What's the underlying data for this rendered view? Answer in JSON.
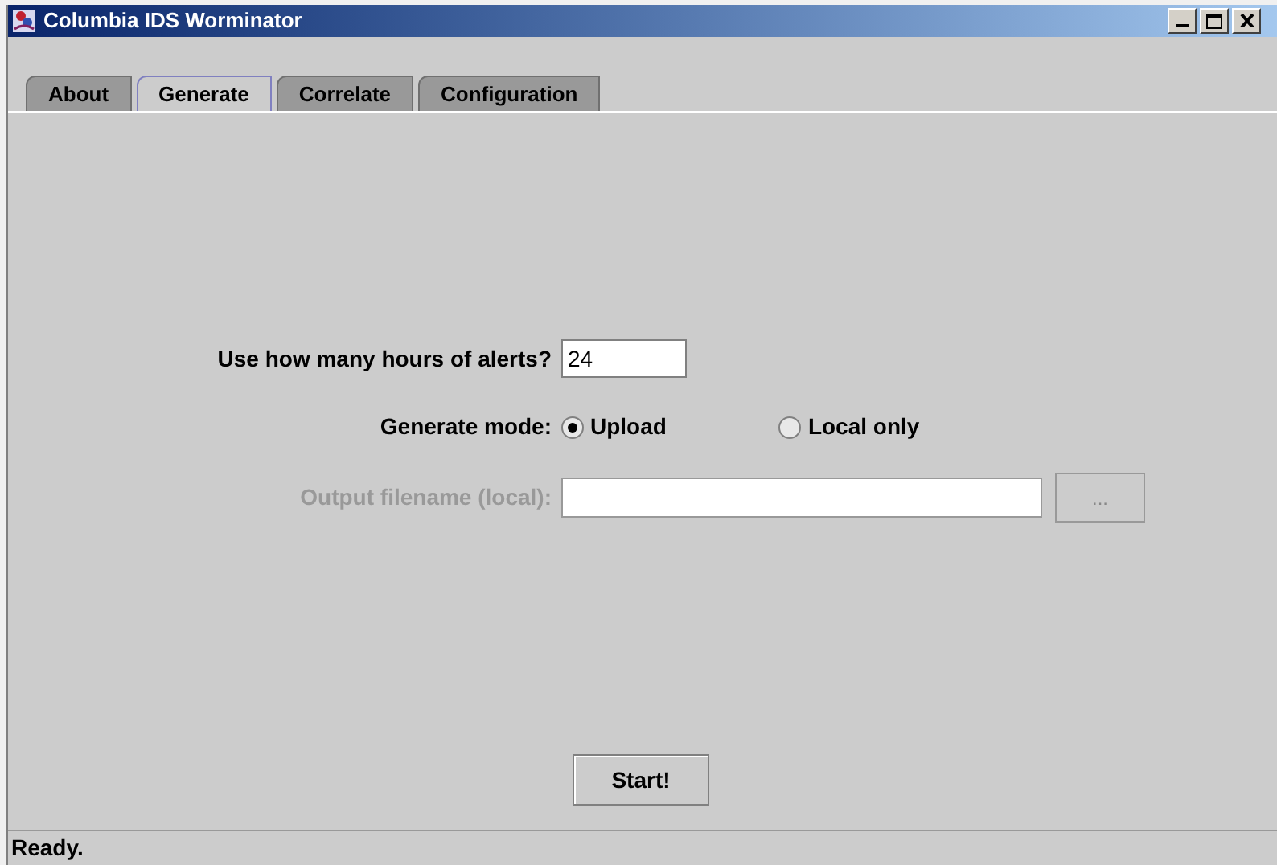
{
  "window": {
    "title": "Columbia IDS Worminator"
  },
  "tabs": [
    {
      "label": "About",
      "selected": false
    },
    {
      "label": "Generate",
      "selected": true
    },
    {
      "label": "Correlate",
      "selected": false
    },
    {
      "label": "Configuration",
      "selected": false
    }
  ],
  "hours": {
    "label": "Use how many hours of alerts?",
    "value": "24"
  },
  "mode": {
    "label": "Generate mode:",
    "options": [
      {
        "label": "Upload",
        "selected": true
      },
      {
        "label": "Local only",
        "selected": false
      }
    ]
  },
  "output": {
    "label": "Output filename (local):",
    "disabled": true,
    "browse": "..."
  },
  "start_button": "Start!",
  "status_bar": "Ready."
}
